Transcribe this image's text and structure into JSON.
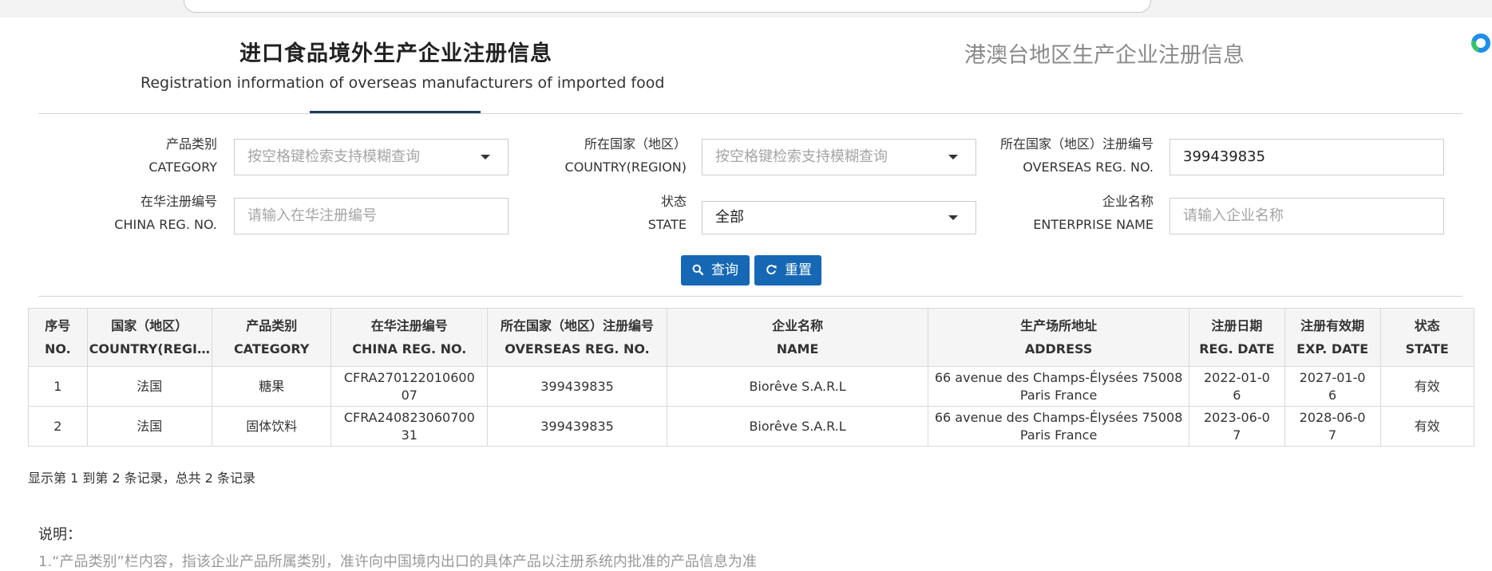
{
  "header": {
    "title_cn": "进口食品境外生产企业注册信息",
    "title_en": "Registration information of overseas manufacturers of imported food",
    "tab_hmt": "港澳台地区生产企业注册信息"
  },
  "form": {
    "category": {
      "label_cn": "产品类别",
      "label_en": "CATEGORY",
      "placeholder": "按空格键检索支持模糊查询"
    },
    "country": {
      "label_cn": "所在国家（地区）",
      "label_en": "COUNTRY(REGION)",
      "placeholder": "按空格键检索支持模糊查询"
    },
    "overseas_reg": {
      "label_cn": "所在国家（地区）注册编号",
      "label_en": "OVERSEAS REG. NO.",
      "value": "399439835"
    },
    "china_reg": {
      "label_cn": "在华注册编号",
      "label_en": "CHINA REG. NO.",
      "placeholder": "请输入在华注册编号"
    },
    "state": {
      "label_cn": "状态",
      "label_en": "STATE",
      "value": "全部"
    },
    "enterprise": {
      "label_cn": "企业名称",
      "label_en": "ENTERPRISE NAME",
      "placeholder": "请输入企业名称"
    },
    "search_label": "查询",
    "reset_label": "重置"
  },
  "table": {
    "columns": [
      {
        "cn": "序号",
        "en": "NO."
      },
      {
        "cn": "国家（地区）",
        "en": "COUNTRY(REGI…"
      },
      {
        "cn": "产品类别",
        "en": "CATEGORY"
      },
      {
        "cn": "在华注册编号",
        "en": "CHINA REG. NO."
      },
      {
        "cn": "所在国家（地区）注册编号",
        "en": "OVERSEAS REG. NO."
      },
      {
        "cn": "企业名称",
        "en": "NAME"
      },
      {
        "cn": "生产场所地址",
        "en": "ADDRESS"
      },
      {
        "cn": "注册日期",
        "en": "REG. DATE"
      },
      {
        "cn": "注册有效期",
        "en": "EXP. DATE"
      },
      {
        "cn": "状态",
        "en": "STATE"
      }
    ],
    "rows": [
      {
        "no": "1",
        "country": "法国",
        "category": "糖果",
        "china_reg_1": "CFRA270122010600",
        "china_reg_2": "07",
        "overseas_reg": "399439835",
        "name": "Biorêve S.A.R.L",
        "address_1": "66 avenue des Champs-Élysées 75008",
        "address_2": "Paris France",
        "reg_date_1": "2022-01-0",
        "reg_date_2": "6",
        "exp_date_1": "2027-01-0",
        "exp_date_2": "6",
        "state": "有效"
      },
      {
        "no": "2",
        "country": "法国",
        "category": "固体饮料",
        "china_reg_1": "CFRA240823060700",
        "china_reg_2": "31",
        "overseas_reg": "399439835",
        "name": "Biorêve S.A.R.L",
        "address_1": "66 avenue des Champs-Élysées 75008",
        "address_2": "Paris France",
        "reg_date_1": "2023-06-0",
        "reg_date_2": "7",
        "exp_date_1": "2028-06-0",
        "exp_date_2": "7",
        "state": "有效"
      }
    ]
  },
  "summary": "显示第 1 到第 2 条记录，总共 2 条记录",
  "notes": {
    "title": "说明：",
    "line1": "1.“产品类别”栏内容，指该企业产品所属类别，准许向中国境内出口的具体产品以注册系统内批准的产品信息为准"
  },
  "colors": {
    "primary_button": "#1668b4",
    "tab_underline": "#1b3d5c",
    "placeholder": "#a5a5a5"
  },
  "icons": [
    "search-icon",
    "refresh-icon",
    "caret-down-icon",
    "edge-browser-icon"
  ]
}
